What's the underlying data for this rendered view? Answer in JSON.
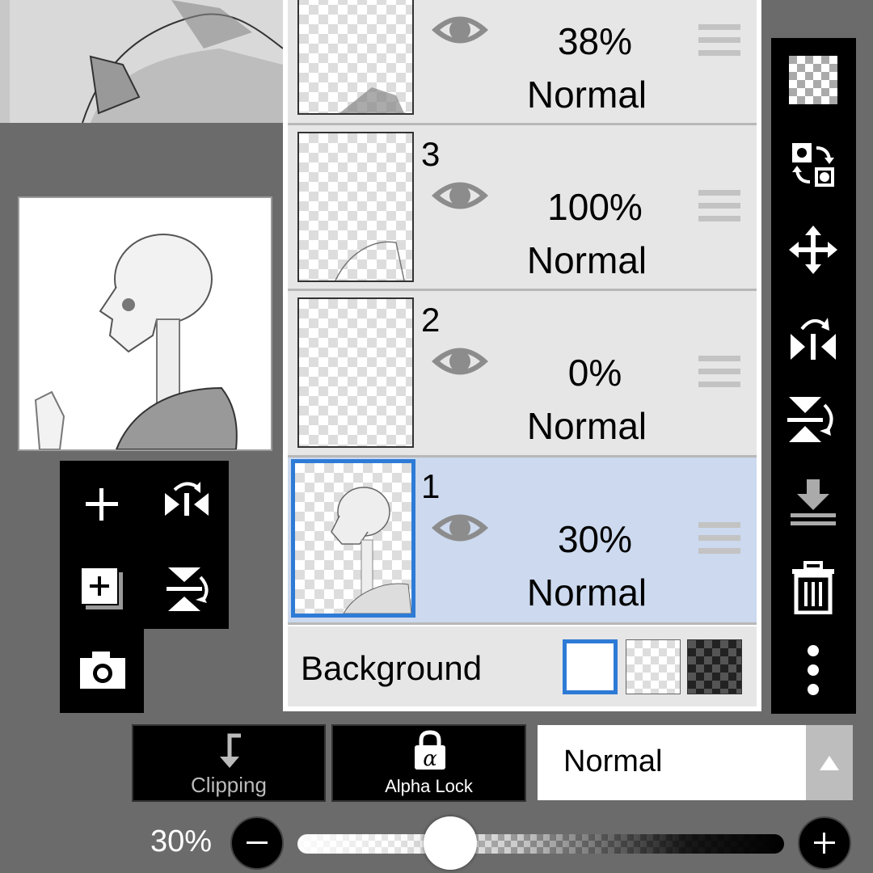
{
  "layers": [
    {
      "number": "",
      "opacity": "38%",
      "blend": "Normal",
      "selected": false
    },
    {
      "number": "3",
      "opacity": "100%",
      "blend": "Normal",
      "selected": false
    },
    {
      "number": "2",
      "opacity": "0%",
      "blend": "Normal",
      "selected": false
    },
    {
      "number": "1",
      "opacity": "30%",
      "blend": "Normal",
      "selected": true
    }
  ],
  "background": {
    "label": "Background",
    "selected_swatch": "white"
  },
  "left_tools": [
    "add-layer",
    "flip-horizontal",
    "add-layer-copy",
    "flip-vertical",
    "camera"
  ],
  "right_toolbar": [
    "transparent-fill",
    "swap-layers",
    "move",
    "flip-horizontal",
    "flip-vertical",
    "merge-down",
    "delete",
    "more-options"
  ],
  "bottom": {
    "clipping_label": "Clipping",
    "alpha_lock_label": "Alpha Lock",
    "blend_mode": "Normal",
    "opacity_label": "30%",
    "opacity_value": 0.3
  },
  "colors": {
    "selected_row": "#ccd9ee",
    "accent": "#2e7bd6"
  }
}
